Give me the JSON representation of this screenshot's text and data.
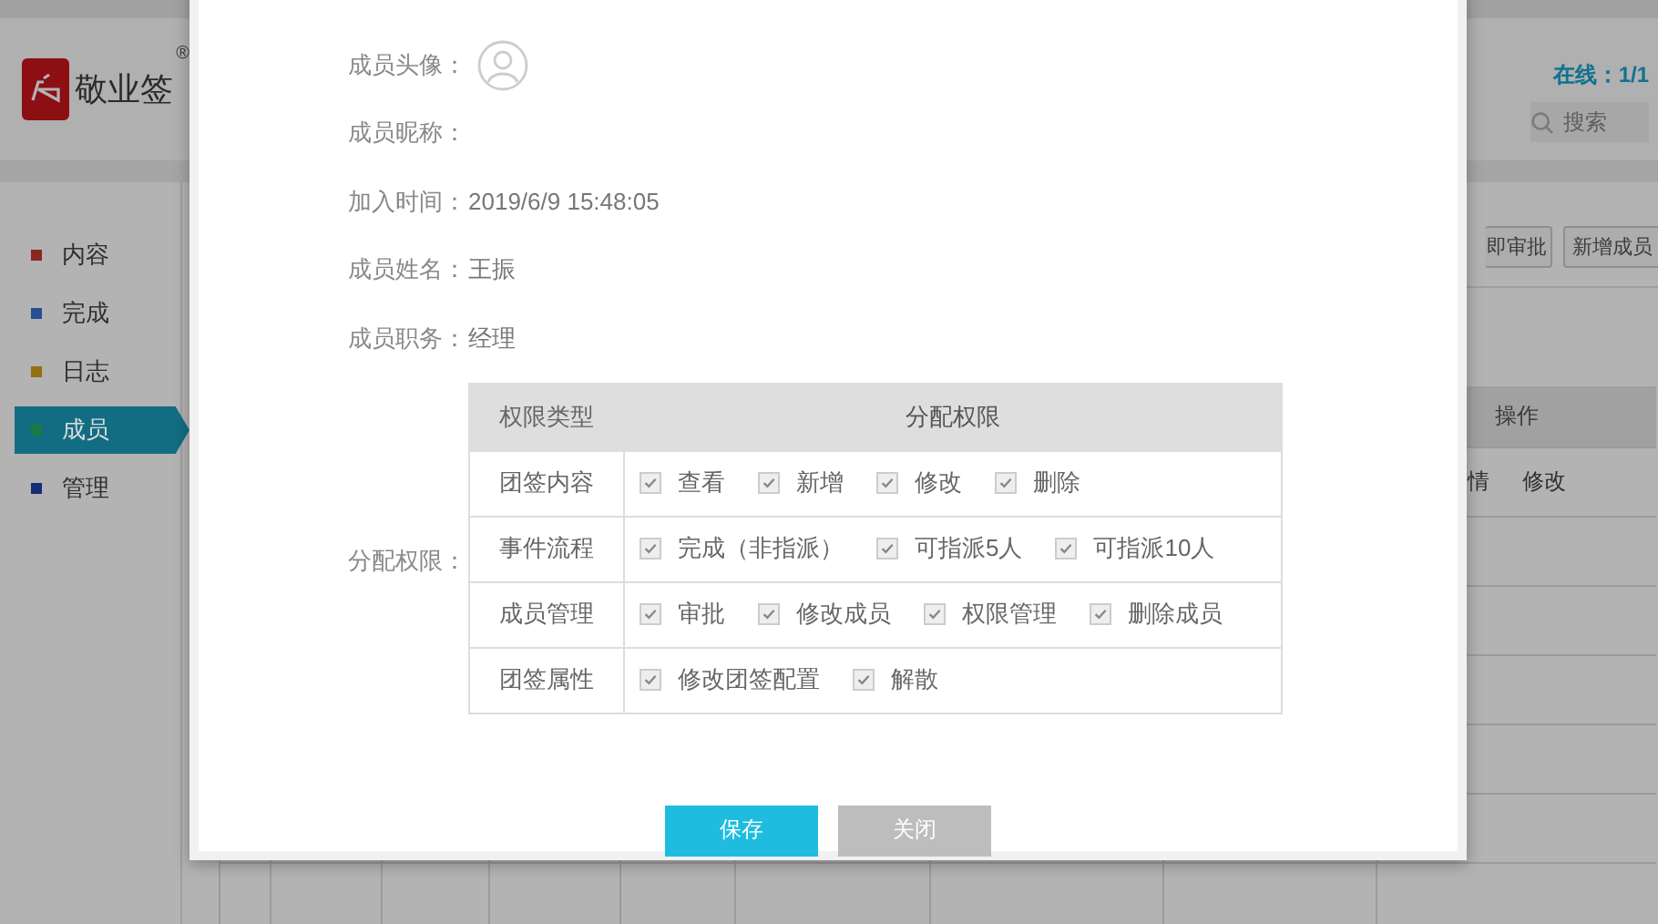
{
  "app": {
    "logo_text": "敬业签",
    "registered_mark": "®",
    "online": "在线：1/1",
    "search_placeholder": "搜索"
  },
  "sidebar": {
    "items": [
      {
        "label": "内容",
        "color": "#86281e",
        "selected": false
      },
      {
        "label": "完成",
        "color": "#294e94",
        "selected": false
      },
      {
        "label": "日志",
        "color": "#947010",
        "selected": false
      },
      {
        "label": "成员",
        "color": "#1b7a43",
        "selected": true
      },
      {
        "label": "管理",
        "color": "#162c76",
        "selected": false
      }
    ]
  },
  "toolbar": {
    "buttons": [
      "即审批",
      "新增成员"
    ]
  },
  "table": {
    "columns": [
      "操作"
    ],
    "rows": [
      [
        "情",
        "修改"
      ]
    ]
  },
  "dialog": {
    "fields": [
      {
        "label": "成员头像：",
        "kind": "avatar"
      },
      {
        "label": "成员昵称：",
        "kind": "text"
      },
      {
        "label": "加入时间：",
        "kind": "text",
        "value": "2019/6/9 15:48:05"
      },
      {
        "label": "成员姓名：",
        "kind": "text",
        "value": "王振"
      },
      {
        "label": "成员职务：",
        "kind": "text",
        "value": "经理"
      }
    ],
    "permissions": {
      "label": "分配权限：",
      "columns": [
        "权限类型",
        "分配权限"
      ],
      "rows": [
        {
          "type": "团签内容",
          "options": [
            {
              "label": "查看",
              "checked": true
            },
            {
              "label": "新增",
              "checked": true
            },
            {
              "label": "修改",
              "checked": true
            },
            {
              "label": "删除",
              "checked": true
            }
          ]
        },
        {
          "type": "事件流程",
          "options": [
            {
              "label": "完成（非指派）",
              "checked": true
            },
            {
              "label": "可指派5人",
              "checked": true
            },
            {
              "label": "可指派10人",
              "checked": true
            }
          ]
        },
        {
          "type": "成员管理",
          "options": [
            {
              "label": "审批",
              "checked": true
            },
            {
              "label": "修改成员",
              "checked": true
            },
            {
              "label": "权限管理",
              "checked": true
            },
            {
              "label": "删除成员",
              "checked": true
            }
          ]
        },
        {
          "type": "团签属性",
          "options": [
            {
              "label": "修改团签配置",
              "checked": true
            },
            {
              "label": "解散",
              "checked": true
            }
          ]
        }
      ]
    },
    "buttons": [
      {
        "label": "保存",
        "kind": "primary"
      },
      {
        "label": "关闭",
        "kind": "secondary"
      }
    ]
  }
}
